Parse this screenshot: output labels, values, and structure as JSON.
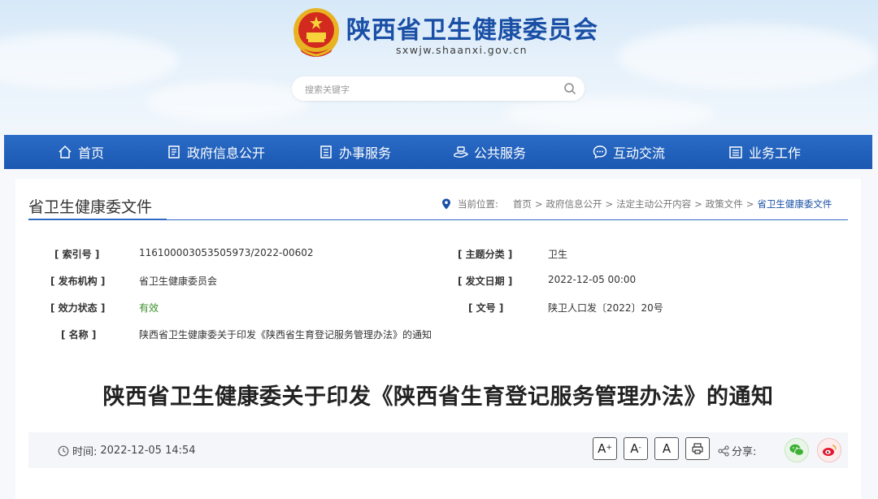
{
  "site": {
    "title": "陕西省卫生健康委员会",
    "domain": "sxwjw.shaanxi.gov.cn"
  },
  "search": {
    "placeholder": "搜索关键字",
    "icon": "search-icon"
  },
  "nav": [
    {
      "label": "首页",
      "icon": "home-icon"
    },
    {
      "label": "政府信息公开",
      "icon": "document-icon"
    },
    {
      "label": "办事服务",
      "icon": "list-icon"
    },
    {
      "label": "公共服务",
      "icon": "service-icon"
    },
    {
      "label": "互动交流",
      "icon": "chat-icon"
    },
    {
      "label": "业务工作",
      "icon": "briefcase-icon"
    }
  ],
  "section": {
    "title": "省卫生健康委文件",
    "breadcrumb": {
      "prefix": "当前位置:",
      "items": [
        "首页",
        "政府信息公开",
        "法定主动公开内容",
        "政策文件",
        "省卫生健康委文件"
      ],
      "separator": ">"
    }
  },
  "meta": {
    "index_label": "[ 索引号 ]",
    "index_value": "116100003053505973/2022-00602",
    "topic_label": "[ 主题分类 ]",
    "topic_value": "卫生",
    "publisher_label": "[ 发布机构 ]",
    "publisher_value": "省卫生健康委员会",
    "date_label": "[ 发文日期 ]",
    "date_value": "2022-12-05 00:00",
    "status_label": "[ 效力状态 ]",
    "status_value": "有效",
    "docno_label": "[ 文号 ]",
    "docno_value": "陕卫人口发〔2022〕20号",
    "name_label": "[ 名称 ]",
    "name_value": "陕西省卫生健康委关于印发《陕西省生育登记服务管理办法》的通知"
  },
  "document": {
    "title": "陕西省卫生健康委关于印发《陕西省生育登记服务管理办法》的通知",
    "time_label": "时间:",
    "time_value": "2022-12-05 14:54"
  },
  "toolbar": {
    "font_large": "A",
    "font_large_mark": "+",
    "font_small": "A",
    "font_small_mark": "-",
    "font_default": "A",
    "print_icon": "print-icon",
    "share_label": "分享:",
    "wechat_icon": "wechat-icon",
    "weibo_icon": "weibo-icon"
  },
  "colors": {
    "brand": "#1a4fa6",
    "nav_bg": "#1f5eb8",
    "valid_green": "#3a8e2a",
    "wechat": "#3cb034",
    "weibo": "#e6162d"
  }
}
